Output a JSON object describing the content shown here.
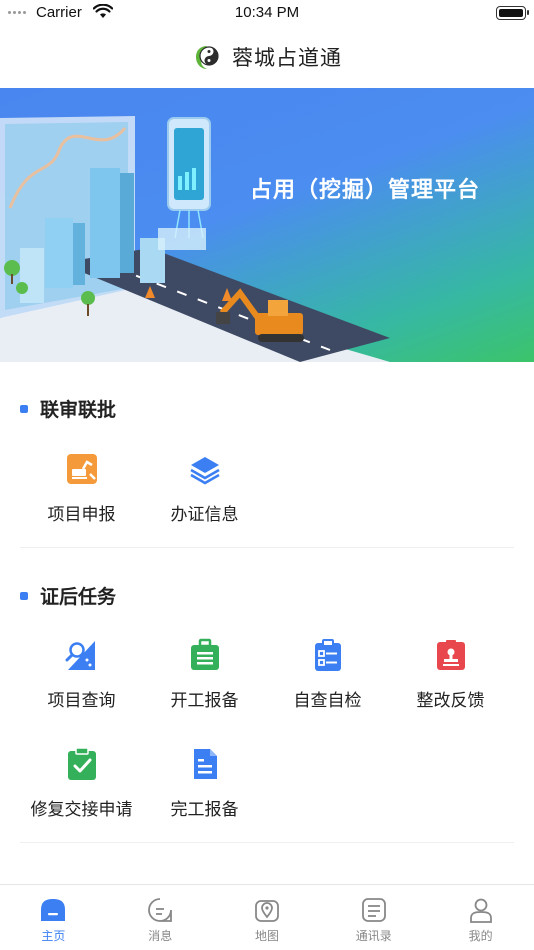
{
  "status_bar": {
    "carrier": "Carrier",
    "time": "10:34 PM"
  },
  "header": {
    "title": "蓉城占道通",
    "logo_icon": "taiji-leaf-logo-icon"
  },
  "banner": {
    "text": "占用（挖掘）管理平台"
  },
  "section_joint": {
    "title": "联审联批",
    "items": [
      {
        "label": "项目申报",
        "icon": "excavator-report-icon",
        "color": "#f59a3b"
      },
      {
        "label": "办证信息",
        "icon": "layers-icon",
        "color": "#3b7ff2"
      }
    ]
  },
  "section_post": {
    "title": "证后任务",
    "items": [
      {
        "label": "项目查询",
        "icon": "search-map-icon",
        "color": "#3b7ff2"
      },
      {
        "label": "开工报备",
        "icon": "briefcase-icon",
        "color": "#35b05a"
      },
      {
        "label": "自查自检",
        "icon": "checklist-icon",
        "color": "#3b7ff2"
      },
      {
        "label": "整改反馈",
        "icon": "stamp-icon",
        "color": "#e8484d"
      },
      {
        "label": "修复交接申请",
        "icon": "clipboard-check-icon",
        "color": "#35b05a"
      },
      {
        "label": "完工报备",
        "icon": "document-icon",
        "color": "#3b7ff2"
      }
    ]
  },
  "tabbar": {
    "tabs": [
      {
        "label": "主页",
        "icon": "home-icon",
        "active": true
      },
      {
        "label": "消息",
        "icon": "message-icon",
        "active": false
      },
      {
        "label": "地图",
        "icon": "map-icon",
        "active": false
      },
      {
        "label": "通讯录",
        "icon": "contacts-icon",
        "active": false
      },
      {
        "label": "我的",
        "icon": "user-icon",
        "active": false
      }
    ]
  }
}
